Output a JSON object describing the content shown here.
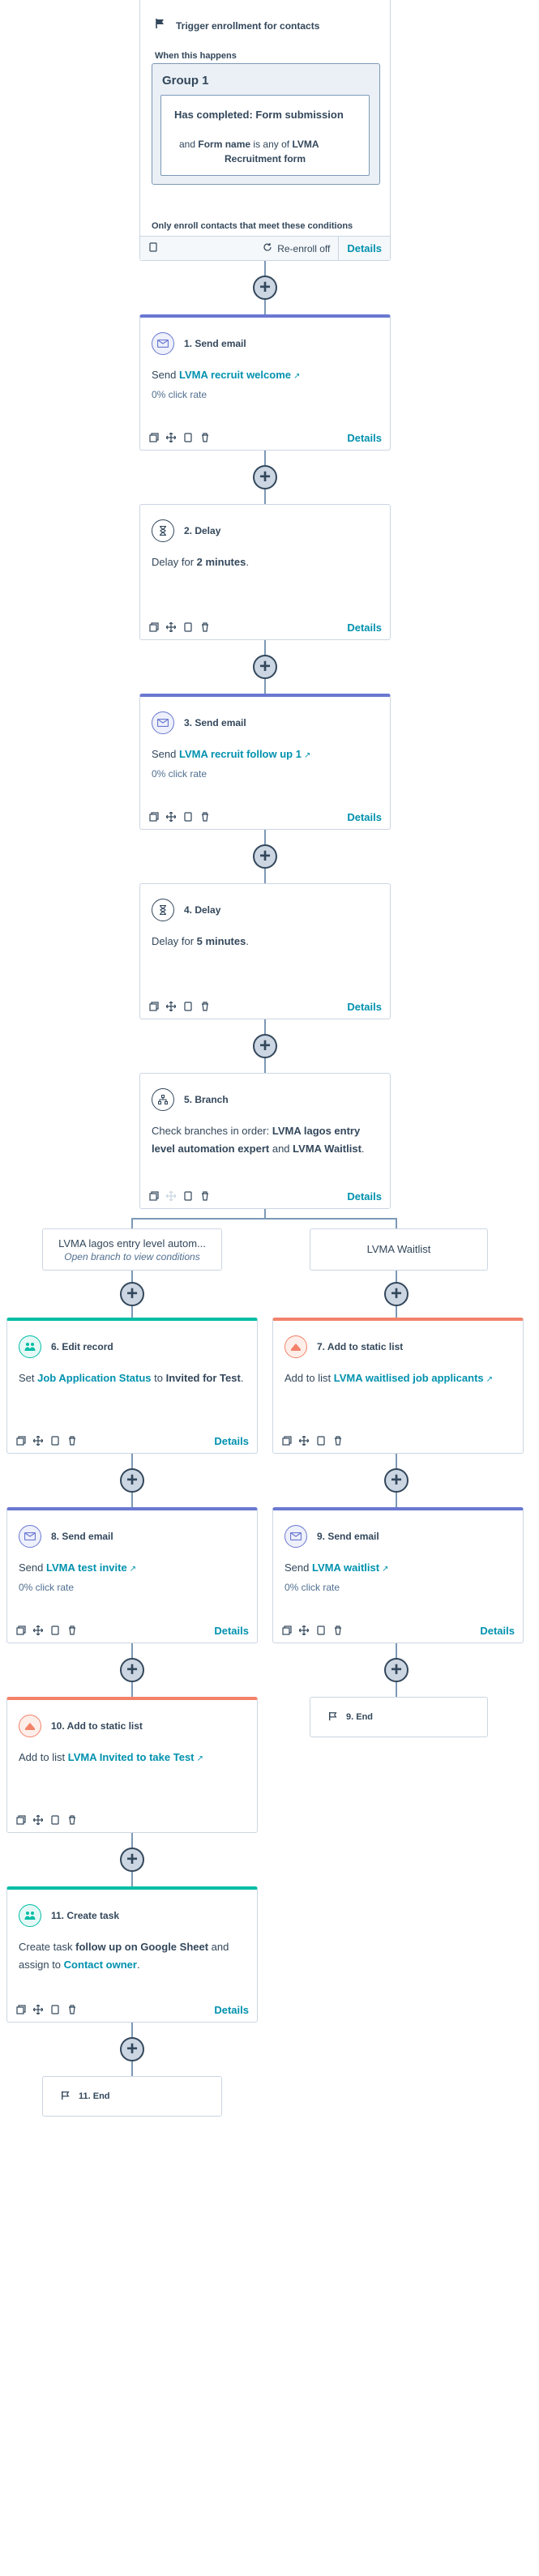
{
  "trigger": {
    "title": "Trigger enrollment for contacts",
    "when_label": "When this happens",
    "group_label": "Group 1",
    "filter_title": "Has completed: Form submission",
    "filter_and": "and",
    "filter_field": "Form name",
    "filter_op": "is any of",
    "filter_value_1": "LVMA",
    "filter_value_2": "Recruitment form",
    "only_enroll": "Only enroll contacts that meet these conditions",
    "reenroll": "Re-enroll off",
    "details": "Details"
  },
  "common": {
    "details": "Details",
    "send": "Send",
    "zero_click": "0% click rate",
    "delay_prefix": "Delay for",
    "add_to_list": "Add to list"
  },
  "steps": {
    "s1": {
      "title": "1. Send email",
      "email": "LVMA recruit welcome"
    },
    "s2": {
      "title": "2. Delay",
      "amount": "2 minutes"
    },
    "s3": {
      "title": "3. Send email",
      "email": "LVMA recruit follow up 1"
    },
    "s4": {
      "title": "4. Delay",
      "amount": "5 minutes"
    },
    "s5": {
      "title": "5. Branch",
      "pre": "Check branches in order:",
      "b1": "LVMA lagos entry level automation expert",
      "and": "and",
      "b2": "LVMA Waitlist"
    },
    "s6": {
      "title": "6. Edit record",
      "pre": "Set",
      "prop": "Job Application Status",
      "to": "to",
      "val": "Invited for Test"
    },
    "s7": {
      "title": "7. Add to static list",
      "list": "LVMA waitlised job applicants"
    },
    "s8": {
      "title": "8. Send email",
      "email": "LVMA test invite"
    },
    "s9": {
      "title": "9. Send email",
      "email": "LVMA waitlist"
    },
    "s10": {
      "title": "10. Add to static list",
      "list": "LVMA Invited to take Test"
    },
    "s11": {
      "title": "11. Create task",
      "pre": "Create task",
      "task": "follow up on Google Sheet",
      "and_assign": "and assign to",
      "owner": "Contact owner"
    }
  },
  "branches": {
    "left_label": "LVMA lagos entry level autom...",
    "left_sub": "Open branch to view conditions",
    "right_label": "LVMA Waitlist"
  },
  "ends": {
    "end9": "9. End",
    "end11": "11. End"
  },
  "icons": {
    "flag": "flag-icon",
    "email": "email-icon",
    "hourglass": "hourglass-icon",
    "branch": "branch-icon",
    "edit": "edit-record-icon",
    "list": "list-icon",
    "task": "task-icon",
    "clone": "clone-icon",
    "move": "move-icon",
    "copy": "copy-icon",
    "delete": "delete-icon",
    "external": "external-link-icon",
    "refresh": "refresh-icon",
    "plus": "plus-icon"
  },
  "colors": {
    "email_accent": "#6a78d1",
    "teal_accent": "#00bda5",
    "coral_accent": "#f2826a",
    "link": "#0091ae",
    "connector": "#7c98b6"
  }
}
